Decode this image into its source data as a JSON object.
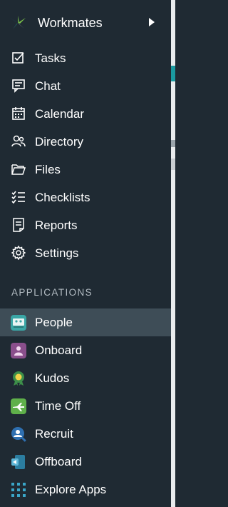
{
  "app": {
    "title": "Workmates"
  },
  "nav": [
    {
      "label": "Tasks",
      "icon": "checkbox-icon"
    },
    {
      "label": "Chat",
      "icon": "chat-icon"
    },
    {
      "label": "Calendar",
      "icon": "calendar-icon"
    },
    {
      "label": "Directory",
      "icon": "people-icon"
    },
    {
      "label": "Files",
      "icon": "folder-icon"
    },
    {
      "label": "Checklists",
      "icon": "checklist-icon"
    },
    {
      "label": "Reports",
      "icon": "report-icon"
    },
    {
      "label": "Settings",
      "icon": "gear-icon"
    }
  ],
  "applications": {
    "heading": "APPLICATIONS",
    "items": [
      {
        "label": "People",
        "icon": "people-app-icon",
        "color": "#3aa6a6",
        "active": true
      },
      {
        "label": "Onboard",
        "icon": "onboard-app-icon",
        "color": "#8a4f8c"
      },
      {
        "label": "Kudos",
        "icon": "kudos-app-icon",
        "color": "#3d8f4a"
      },
      {
        "label": "Time Off",
        "icon": "time-off-app-icon",
        "color": "#5fb04a"
      },
      {
        "label": "Recruit",
        "icon": "recruit-app-icon",
        "color": "#2e6fb0"
      },
      {
        "label": "Offboard",
        "icon": "offboard-app-icon",
        "color": "#2b7da0"
      },
      {
        "label": "Explore Apps",
        "icon": "grid-icon",
        "color": "#3aa6c8"
      }
    ]
  },
  "colors": {
    "sidebar_bg": "#1f2a33",
    "active_bg": "#3e4d57",
    "section_text": "#b3bcc3"
  }
}
